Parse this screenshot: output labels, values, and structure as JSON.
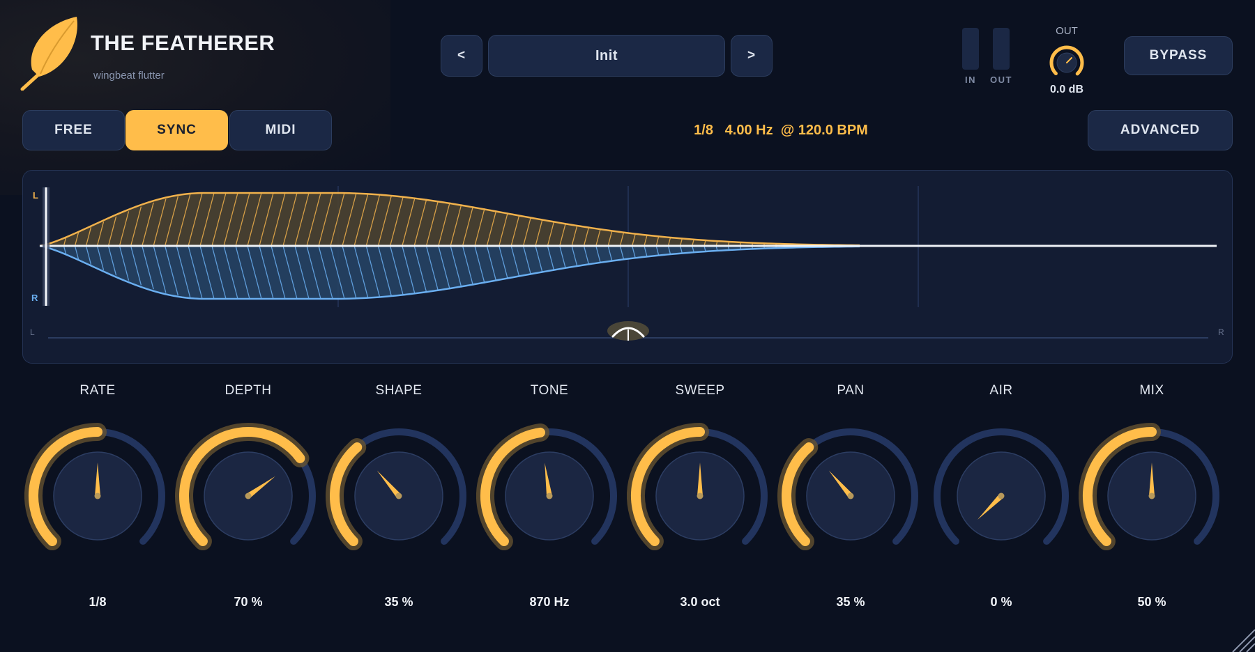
{
  "app": {
    "title": "THE FEATHERER",
    "subtitle": "wingbeat flutter"
  },
  "preset": {
    "prev_label": "<",
    "name": "Init",
    "next_label": ">"
  },
  "meters": {
    "in_label": "IN",
    "out_label": "OUT"
  },
  "output": {
    "label": "OUT",
    "value": "0.0 dB"
  },
  "bypass_label": "BYPASS",
  "modes": [
    {
      "label": "FREE",
      "active": false
    },
    {
      "label": "SYNC",
      "active": true
    },
    {
      "label": "MIDI",
      "active": false
    }
  ],
  "sync_info": {
    "division": "1/8",
    "rate": "4.00 Hz",
    "tempo": "@ 120.0 BPM"
  },
  "advanced_label": "ADVANCED",
  "display": {
    "left_label": "L",
    "right_label": "R",
    "pan_left": "L",
    "pan_right": "R"
  },
  "knobs": [
    {
      "label": "RATE",
      "value": "1/8",
      "level": 0.5
    },
    {
      "label": "DEPTH",
      "value": "70 %",
      "level": 0.7
    },
    {
      "label": "SHAPE",
      "value": "35 %",
      "level": 0.35
    },
    {
      "label": "TONE",
      "value": "870 Hz",
      "level": 0.47
    },
    {
      "label": "SWEEP",
      "value": "3.0 oct",
      "level": 0.5
    },
    {
      "label": "PAN",
      "value": "35 %",
      "level": 0.35
    },
    {
      "label": "AIR",
      "value": "0 %",
      "level": 0.0
    },
    {
      "label": "MIX",
      "value": "50 %",
      "level": 0.5
    }
  ],
  "colors": {
    "accent": "#ffbd4a",
    "left_channel": "#f0b14c",
    "right_channel": "#6aaef0",
    "background": "#0b1120",
    "panel": "#1b2845",
    "track": "#22345e"
  }
}
